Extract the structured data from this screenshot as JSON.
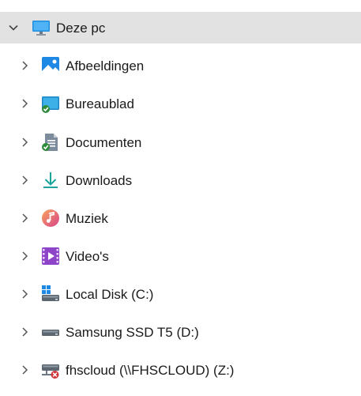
{
  "tree": {
    "root": {
      "label": "Deze pc",
      "expanded": true,
      "icon": "monitor-icon"
    },
    "items": [
      {
        "label": "Afbeeldingen",
        "icon": "pictures-icon"
      },
      {
        "label": "Bureaublad",
        "icon": "desktop-icon"
      },
      {
        "label": "Documenten",
        "icon": "documents-icon"
      },
      {
        "label": "Downloads",
        "icon": "downloads-icon"
      },
      {
        "label": "Muziek",
        "icon": "music-icon"
      },
      {
        "label": "Video's",
        "icon": "videos-icon"
      },
      {
        "label": "Local Disk (C:)",
        "icon": "system-drive-icon"
      },
      {
        "label": "Samsung SSD T5 (D:)",
        "icon": "drive-icon"
      },
      {
        "label": "fhscloud (\\\\FHSCLOUD) (Z:)",
        "icon": "network-drive-disconnected-icon"
      }
    ]
  },
  "colors": {
    "selected_row": "#e2e2e2",
    "chevron": "#555555",
    "sync_badge": "#2e8b3a",
    "accent_blue": "#1e88e5",
    "error_red": "#d13438"
  }
}
